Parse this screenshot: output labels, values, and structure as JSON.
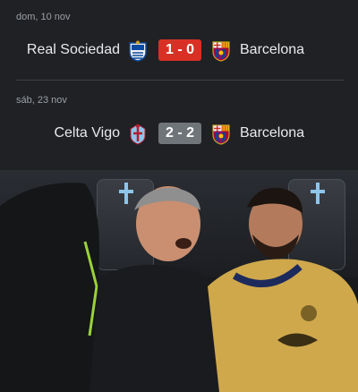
{
  "matches": [
    {
      "date": "dom, 10 nov",
      "home_team": "Real Sociedad",
      "home_crest": "real-sociedad-crest",
      "score": "1 - 0",
      "score_color": "#d93025",
      "away_team": "Barcelona",
      "away_crest": "barcelona-crest"
    },
    {
      "date": "sáb, 23 nov",
      "home_team": "Celta Vigo",
      "home_crest": "celta-vigo-crest",
      "score": "2 - 2",
      "score_color": "#70757a",
      "away_team": "Barcelona",
      "away_crest": "barcelona-crest"
    }
  ],
  "colors": {
    "background": "#202124",
    "text": "#e8eaed",
    "muted_text": "#9aa0a6",
    "loss": "#d93025",
    "draw": "#70757a"
  },
  "photo": {
    "description_icon": "bench-photo"
  }
}
